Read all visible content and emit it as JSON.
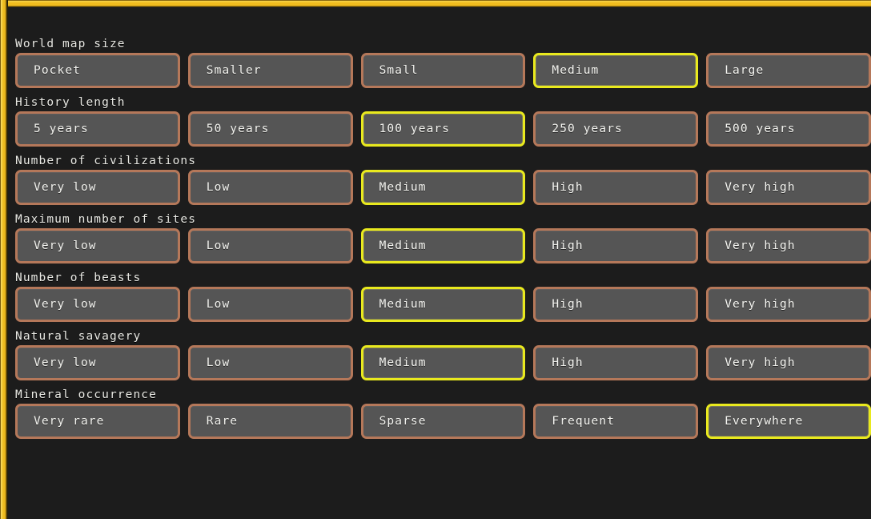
{
  "screen": {
    "background_color": "#1c1c1c",
    "frame_color": "#f0bc1e",
    "button_fill_color": "#555555",
    "button_border_color": "#b5785a",
    "selected_border_color": "#e9e91e",
    "text_color": "#f2f2ee"
  },
  "groups": [
    {
      "label": "World map size",
      "options": [
        {
          "label": "Pocket",
          "selected": false
        },
        {
          "label": "Smaller",
          "selected": false
        },
        {
          "label": "Small",
          "selected": false
        },
        {
          "label": "Medium",
          "selected": true
        },
        {
          "label": "Large",
          "selected": false
        }
      ]
    },
    {
      "label": "History length",
      "options": [
        {
          "label": "5 years",
          "selected": false
        },
        {
          "label": "50 years",
          "selected": false
        },
        {
          "label": "100 years",
          "selected": true
        },
        {
          "label": "250 years",
          "selected": false
        },
        {
          "label": "500 years",
          "selected": false
        }
      ]
    },
    {
      "label": "Number of civilizations",
      "options": [
        {
          "label": "Very low",
          "selected": false
        },
        {
          "label": "Low",
          "selected": false
        },
        {
          "label": "Medium",
          "selected": true
        },
        {
          "label": "High",
          "selected": false
        },
        {
          "label": "Very high",
          "selected": false
        }
      ]
    },
    {
      "label": "Maximum number of sites",
      "options": [
        {
          "label": "Very low",
          "selected": false
        },
        {
          "label": "Low",
          "selected": false
        },
        {
          "label": "Medium",
          "selected": true
        },
        {
          "label": "High",
          "selected": false
        },
        {
          "label": "Very high",
          "selected": false
        }
      ]
    },
    {
      "label": "Number of beasts",
      "options": [
        {
          "label": "Very low",
          "selected": false
        },
        {
          "label": "Low",
          "selected": false
        },
        {
          "label": "Medium",
          "selected": true
        },
        {
          "label": "High",
          "selected": false
        },
        {
          "label": "Very high",
          "selected": false
        }
      ]
    },
    {
      "label": "Natural savagery",
      "options": [
        {
          "label": "Very low",
          "selected": false
        },
        {
          "label": "Low",
          "selected": false
        },
        {
          "label": "Medium",
          "selected": true
        },
        {
          "label": "High",
          "selected": false
        },
        {
          "label": "Very high",
          "selected": false
        }
      ]
    },
    {
      "label": "Mineral occurrence",
      "options": [
        {
          "label": "Very rare",
          "selected": false
        },
        {
          "label": "Rare",
          "selected": false
        },
        {
          "label": "Sparse",
          "selected": false
        },
        {
          "label": "Frequent",
          "selected": false
        },
        {
          "label": "Everywhere",
          "selected": true
        }
      ]
    }
  ]
}
